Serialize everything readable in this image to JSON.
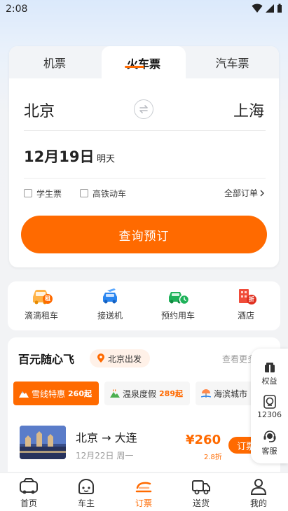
{
  "status_bar": {
    "time": "2:08"
  },
  "booking": {
    "tabs": [
      {
        "label": "机票",
        "active": false
      },
      {
        "label": "火车票",
        "active": true
      },
      {
        "label": "汽车票",
        "active": false
      }
    ],
    "from_city": "北京",
    "to_city": "上海",
    "date": "12月19日",
    "date_hint": "明天",
    "options": [
      {
        "label": "学生票",
        "checked": false
      },
      {
        "label": "高铁动车",
        "checked": false
      }
    ],
    "all_orders_label": "全部订单",
    "search_button": "查询预订"
  },
  "services": [
    {
      "label": "滴滴租车",
      "icon": "car-rental-icon",
      "badge": "租"
    },
    {
      "label": "接送机",
      "icon": "airport-transfer-icon"
    },
    {
      "label": "预约用车",
      "icon": "scheduled-car-icon"
    },
    {
      "label": "酒店",
      "icon": "hotel-icon",
      "badge": "折"
    }
  ],
  "feature": {
    "title": "百元随心飞",
    "depart_chip": "北京出发",
    "see_more": "查看更多",
    "chips": [
      {
        "label": "雪线特惠",
        "price": "260起",
        "active": true
      },
      {
        "label": "温泉度假",
        "price": "289起",
        "active": false
      },
      {
        "label": "海滨城市",
        "price": "",
        "active": false
      }
    ],
    "trip": {
      "route": "北京 → 大连",
      "date": "12月22日 周一",
      "price": "¥260",
      "discount": "2.8折",
      "book_label": "订票"
    }
  },
  "float_panel": [
    {
      "label": "权益",
      "icon": "benefits-icon"
    },
    {
      "label": "12306",
      "icon": "railway-12306-icon"
    },
    {
      "label": "客服",
      "icon": "customer-service-icon"
    }
  ],
  "bottom_nav": [
    {
      "label": "首页",
      "icon": "home-icon",
      "active": false
    },
    {
      "label": "车主",
      "icon": "car-owner-icon",
      "active": false
    },
    {
      "label": "订票",
      "icon": "tickets-icon",
      "active": true
    },
    {
      "label": "送货",
      "icon": "delivery-truck-icon",
      "active": false
    },
    {
      "label": "我的",
      "icon": "profile-icon",
      "active": false
    }
  ],
  "colors": {
    "accent": "#ff6a00",
    "blue": "#2a86f0",
    "green": "#1fb25a",
    "red": "#f04c3a"
  }
}
